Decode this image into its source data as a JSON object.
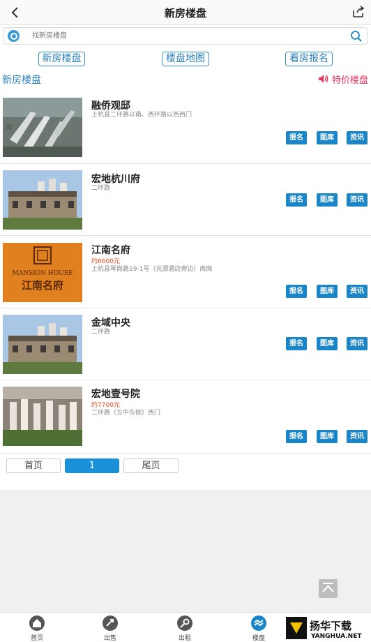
{
  "header": {
    "title": "新房楼盘"
  },
  "search": {
    "placeholder": "找新房楼盘"
  },
  "tabs": [
    {
      "label": "新房楼盘"
    },
    {
      "label": "楼盘地图"
    },
    {
      "label": "看房报名"
    }
  ],
  "subhead": {
    "left": "新房楼盘",
    "right": "特价楼盘"
  },
  "items": [
    {
      "name": "融侨观邸",
      "price": "",
      "addr": "上杭县二环路以南、西环路以西西门",
      "thumb": "aerial"
    },
    {
      "name": "宏地杭川府",
      "price": "",
      "addr": "二环路",
      "thumb": "villa"
    },
    {
      "name": "江南名府",
      "price": "约6600元",
      "addr": "上杭县琴岗路19-1号（光源酒店旁边）南岗",
      "thumb": "mansion",
      "thumb_text": "MANSION HOUSE",
      "thumb_text2": "江南名府"
    },
    {
      "name": "金域中央",
      "price": "",
      "addr": "二环路",
      "thumb": "villa"
    },
    {
      "name": "宏地壹号院",
      "price": "约7700元",
      "addr": "二环路（五中东侧）西门",
      "thumb": "model"
    }
  ],
  "buttons": {
    "signup": "报名",
    "gallery": "图库",
    "news": "资讯"
  },
  "pager": {
    "first": "首页",
    "current": "1",
    "last": "尾页"
  },
  "bottom_nav": [
    {
      "label": "首页",
      "icon": "home-icon"
    },
    {
      "label": "出售",
      "icon": "sell-icon"
    },
    {
      "label": "出租",
      "icon": "rent-icon"
    },
    {
      "label": "楼盘",
      "icon": "building-icon"
    }
  ],
  "watermark": {
    "cn": "扬华下载",
    "en": "YANGHUA.NET"
  },
  "colors": {
    "accent": "#1a86c8",
    "highlight": "#e8335a",
    "price": "#e84c1c"
  }
}
